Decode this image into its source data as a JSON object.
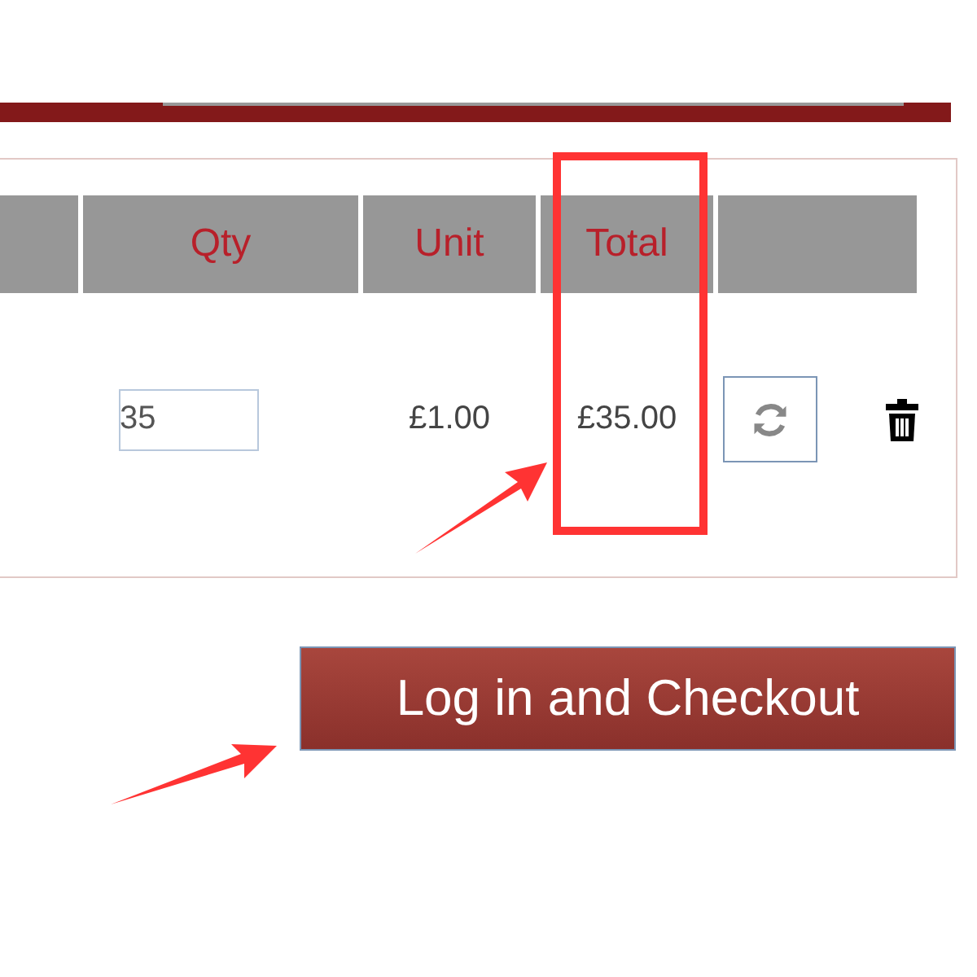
{
  "table": {
    "columns": [
      "Qty",
      "Unit",
      "Total"
    ],
    "rows": [
      {
        "qty": "35",
        "unit": "£1.00",
        "total": "£35.00"
      }
    ]
  },
  "checkout_button": "Log in and Checkout"
}
